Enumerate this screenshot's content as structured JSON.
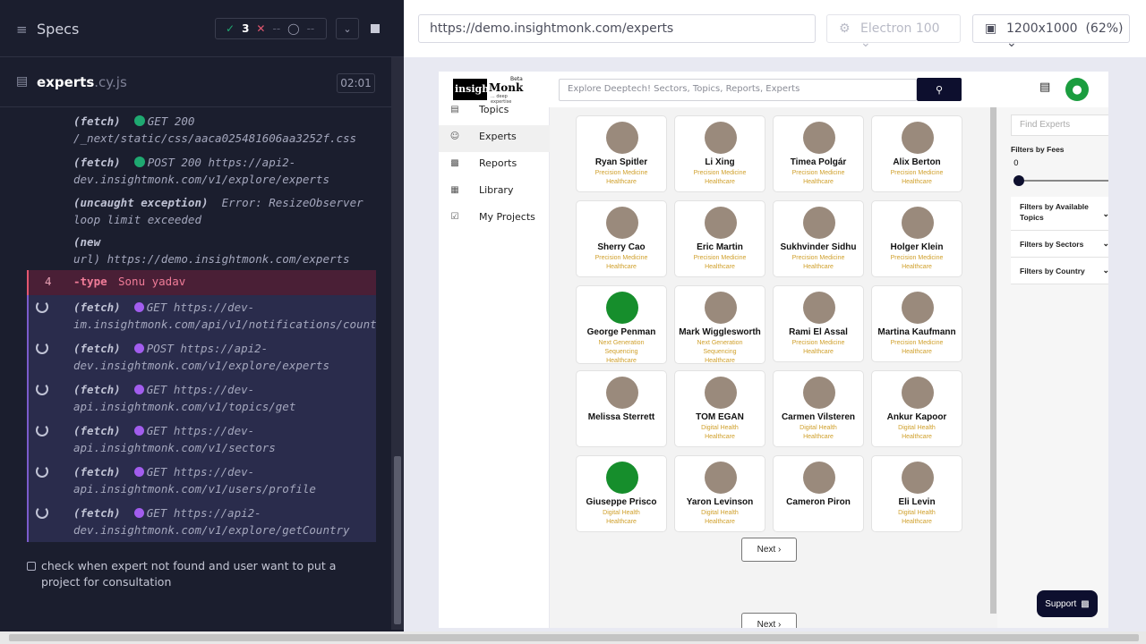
{
  "runner": {
    "title": "Specs",
    "stats": {
      "passed": "3",
      "failed": "--",
      "pending": "--"
    },
    "file": {
      "name": "experts",
      "ext": ".cy.js",
      "time": "02:01"
    },
    "log": [
      {
        "kind": "(fetch)",
        "status": "green",
        "text": "GET 200",
        "line2": "/_next/static/css/aaca025481606aa3252f.css"
      },
      {
        "kind": "(fetch)",
        "status": "green",
        "text": "POST 200 https://api2-",
        "line2": "dev.insightmonk.com/v1/explore/experts"
      },
      {
        "kind": "(uncaught exception)",
        "status": "",
        "text": "Error: ResizeObserver",
        "line2": "loop limit exceeded"
      },
      {
        "kind": "(new",
        "status": "",
        "text": "",
        "line2": "url) https://demo.insightmonk.com/experts"
      }
    ],
    "typeCmd": {
      "num": "4",
      "cmd": "-type",
      "arg": "Sonu yadav"
    },
    "pending": [
      {
        "kind": "(fetch)",
        "text": "GET https://dev-",
        "line2": "im.insightmonk.com/api/v1/notifications/count"
      },
      {
        "kind": "(fetch)",
        "text": "POST https://api2-",
        "line2": "dev.insightmonk.com/v1/explore/experts"
      },
      {
        "kind": "(fetch)",
        "text": "GET https://dev-",
        "line2": "api.insightmonk.com/v1/topics/get"
      },
      {
        "kind": "(fetch)",
        "text": "GET https://dev-",
        "line2": "api.insightmonk.com/v1/sectors"
      },
      {
        "kind": "(fetch)",
        "text": "GET https://dev-",
        "line2": "api.insightmonk.com/v1/users/profile"
      },
      {
        "kind": "(fetch)",
        "text": "GET https://api2-",
        "line2": "dev.insightmonk.com/v1/explore/getCountry"
      }
    ],
    "testTitle": "check when expert not found and user want to put a project for consultation"
  },
  "browserBar": {
    "url": "https://demo.insightmonk.com/experts",
    "browser": "Electron 100",
    "viewport": "1200x1000",
    "zoom": "(62%)"
  },
  "app": {
    "logo": {
      "block": "insight",
      "monk": "Monk",
      "beta": "Beta",
      "tagline": "... deep expertise"
    },
    "searchPlaceholder": "Explore Deeptech! Sectors, Topics,  Reports, Experts",
    "sidebar": [
      "Topics",
      "Experts",
      "Reports",
      "Library",
      "My Projects"
    ],
    "experts": [
      {
        "name": "Ryan Spitler",
        "tags": [
          "Precision Medicine",
          "Healthcare"
        ],
        "green": false
      },
      {
        "name": "Li Xing",
        "tags": [
          "Precision Medicine",
          "Healthcare"
        ],
        "green": false
      },
      {
        "name": "Timea Polgár",
        "tags": [
          "Precision Medicine",
          "Healthcare"
        ],
        "green": false
      },
      {
        "name": "Alix Berton",
        "tags": [
          "Precision Medicine",
          "Healthcare"
        ],
        "green": false
      },
      {
        "name": "Sherry Cao",
        "tags": [
          "Precision Medicine",
          "Healthcare"
        ],
        "green": false
      },
      {
        "name": "Eric Martin",
        "tags": [
          "Precision Medicine",
          "Healthcare"
        ],
        "green": false
      },
      {
        "name": "Sukhvinder Sidhu",
        "tags": [
          "Precision Medicine",
          "Healthcare"
        ],
        "green": false
      },
      {
        "name": "Holger Klein",
        "tags": [
          "Precision Medicine",
          "Healthcare"
        ],
        "green": false
      },
      {
        "name": "George Penman",
        "tags": [
          "Next Generation",
          "Sequencing",
          "Healthcare"
        ],
        "green": true
      },
      {
        "name": "Mark Wigglesworth",
        "tags": [
          "Next Generation",
          "Sequencing",
          "Healthcare"
        ],
        "green": false
      },
      {
        "name": "Rami El Assal",
        "tags": [
          "Precision Medicine",
          "Healthcare"
        ],
        "green": false
      },
      {
        "name": "Martina Kaufmann",
        "tags": [
          "Precision Medicine",
          "Healthcare"
        ],
        "green": false
      },
      {
        "name": "Melissa Sterrett",
        "tags": [],
        "green": false
      },
      {
        "name": "TOM EGAN",
        "tags": [
          "Digital Health",
          "Healthcare"
        ],
        "green": false
      },
      {
        "name": "Carmen Vilsteren",
        "tags": [
          "Digital Health",
          "Healthcare"
        ],
        "green": false
      },
      {
        "name": "Ankur Kapoor",
        "tags": [
          "Digital Health",
          "Healthcare"
        ],
        "green": false
      },
      {
        "name": "Giuseppe Prisco",
        "tags": [
          "Digital Health",
          "Healthcare"
        ],
        "green": true
      },
      {
        "name": "Yaron Levinson",
        "tags": [
          "Digital Health",
          "Healthcare"
        ],
        "green": false
      },
      {
        "name": "Cameron Piron",
        "tags": [],
        "green": false
      },
      {
        "name": "Eli Levin",
        "tags": [
          "Digital Health",
          "Healthcare"
        ],
        "green": false
      }
    ],
    "next": "Next",
    "filters": {
      "findPlaceholder": "Find Experts",
      "feesLabel": "Filters by Fees",
      "feesValue": "0",
      "groups": [
        "Filters by Available Topics",
        "Filters by Sectors",
        "Filters by Country"
      ]
    },
    "support": "Support"
  }
}
